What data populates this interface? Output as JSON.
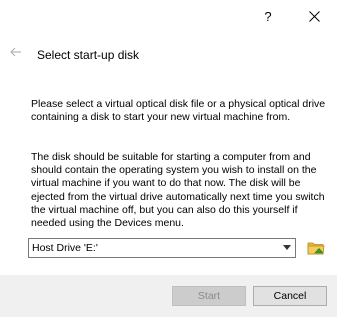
{
  "titlebar": {
    "help_label": "?",
    "close_icon": "close-icon"
  },
  "header": {
    "back_icon": "back-arrow-icon",
    "title": "Select start-up disk"
  },
  "body": {
    "paragraph1": "Please select a virtual optical disk file or a physical optical drive containing a disk to start your new virtual machine from.",
    "paragraph2": "The disk should be suitable for starting a computer from and should contain the operating system you wish to install on the virtual machine if you want to do that now. The disk will be ejected from the virtual drive automatically next time you switch the virtual machine off, but you can also do this yourself if needed using the Devices menu."
  },
  "disk_selector": {
    "selected": "Host Drive 'E:'",
    "chooser_icon": "folder-icon"
  },
  "buttons": {
    "start_label": "Start",
    "start_enabled": false,
    "cancel_label": "Cancel"
  },
  "colors": {
    "button_bar": "#f0f0f0",
    "disabled_button": "#cccccc",
    "folder_yellow": "#e8b83c",
    "folder_green": "#3a9b2e"
  }
}
